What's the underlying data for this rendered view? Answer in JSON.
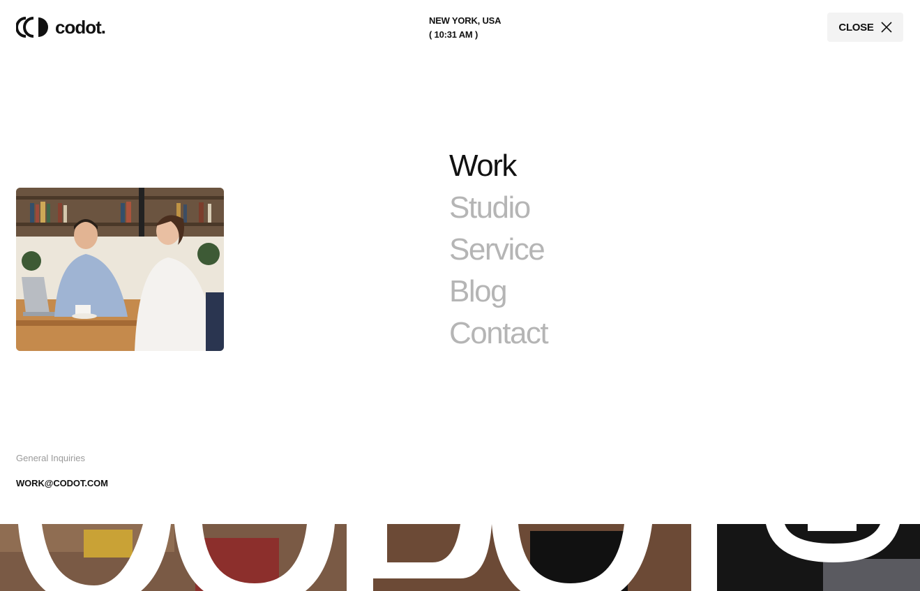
{
  "brand": {
    "name": "codot."
  },
  "header": {
    "location_line1": "NEW YORK, USA",
    "location_line2": "( 10:31 AM )",
    "close_label": "CLOSE"
  },
  "nav": {
    "items": [
      {
        "label": "Work",
        "active": true
      },
      {
        "label": "Studio",
        "active": false
      },
      {
        "label": "Service",
        "active": false
      },
      {
        "label": "Blog",
        "active": false
      },
      {
        "label": "Contact",
        "active": false
      }
    ]
  },
  "contact": {
    "label": "General Inquiries",
    "email": "WORK@CODOT.COM"
  },
  "colors": {
    "text": "#111111",
    "muted_nav": "#b5b5b5",
    "close_bg": "#f3f3f3",
    "label_gray": "#9a9a9a"
  },
  "icons": {
    "logo": "codot-logo-icon",
    "close": "close-icon"
  }
}
